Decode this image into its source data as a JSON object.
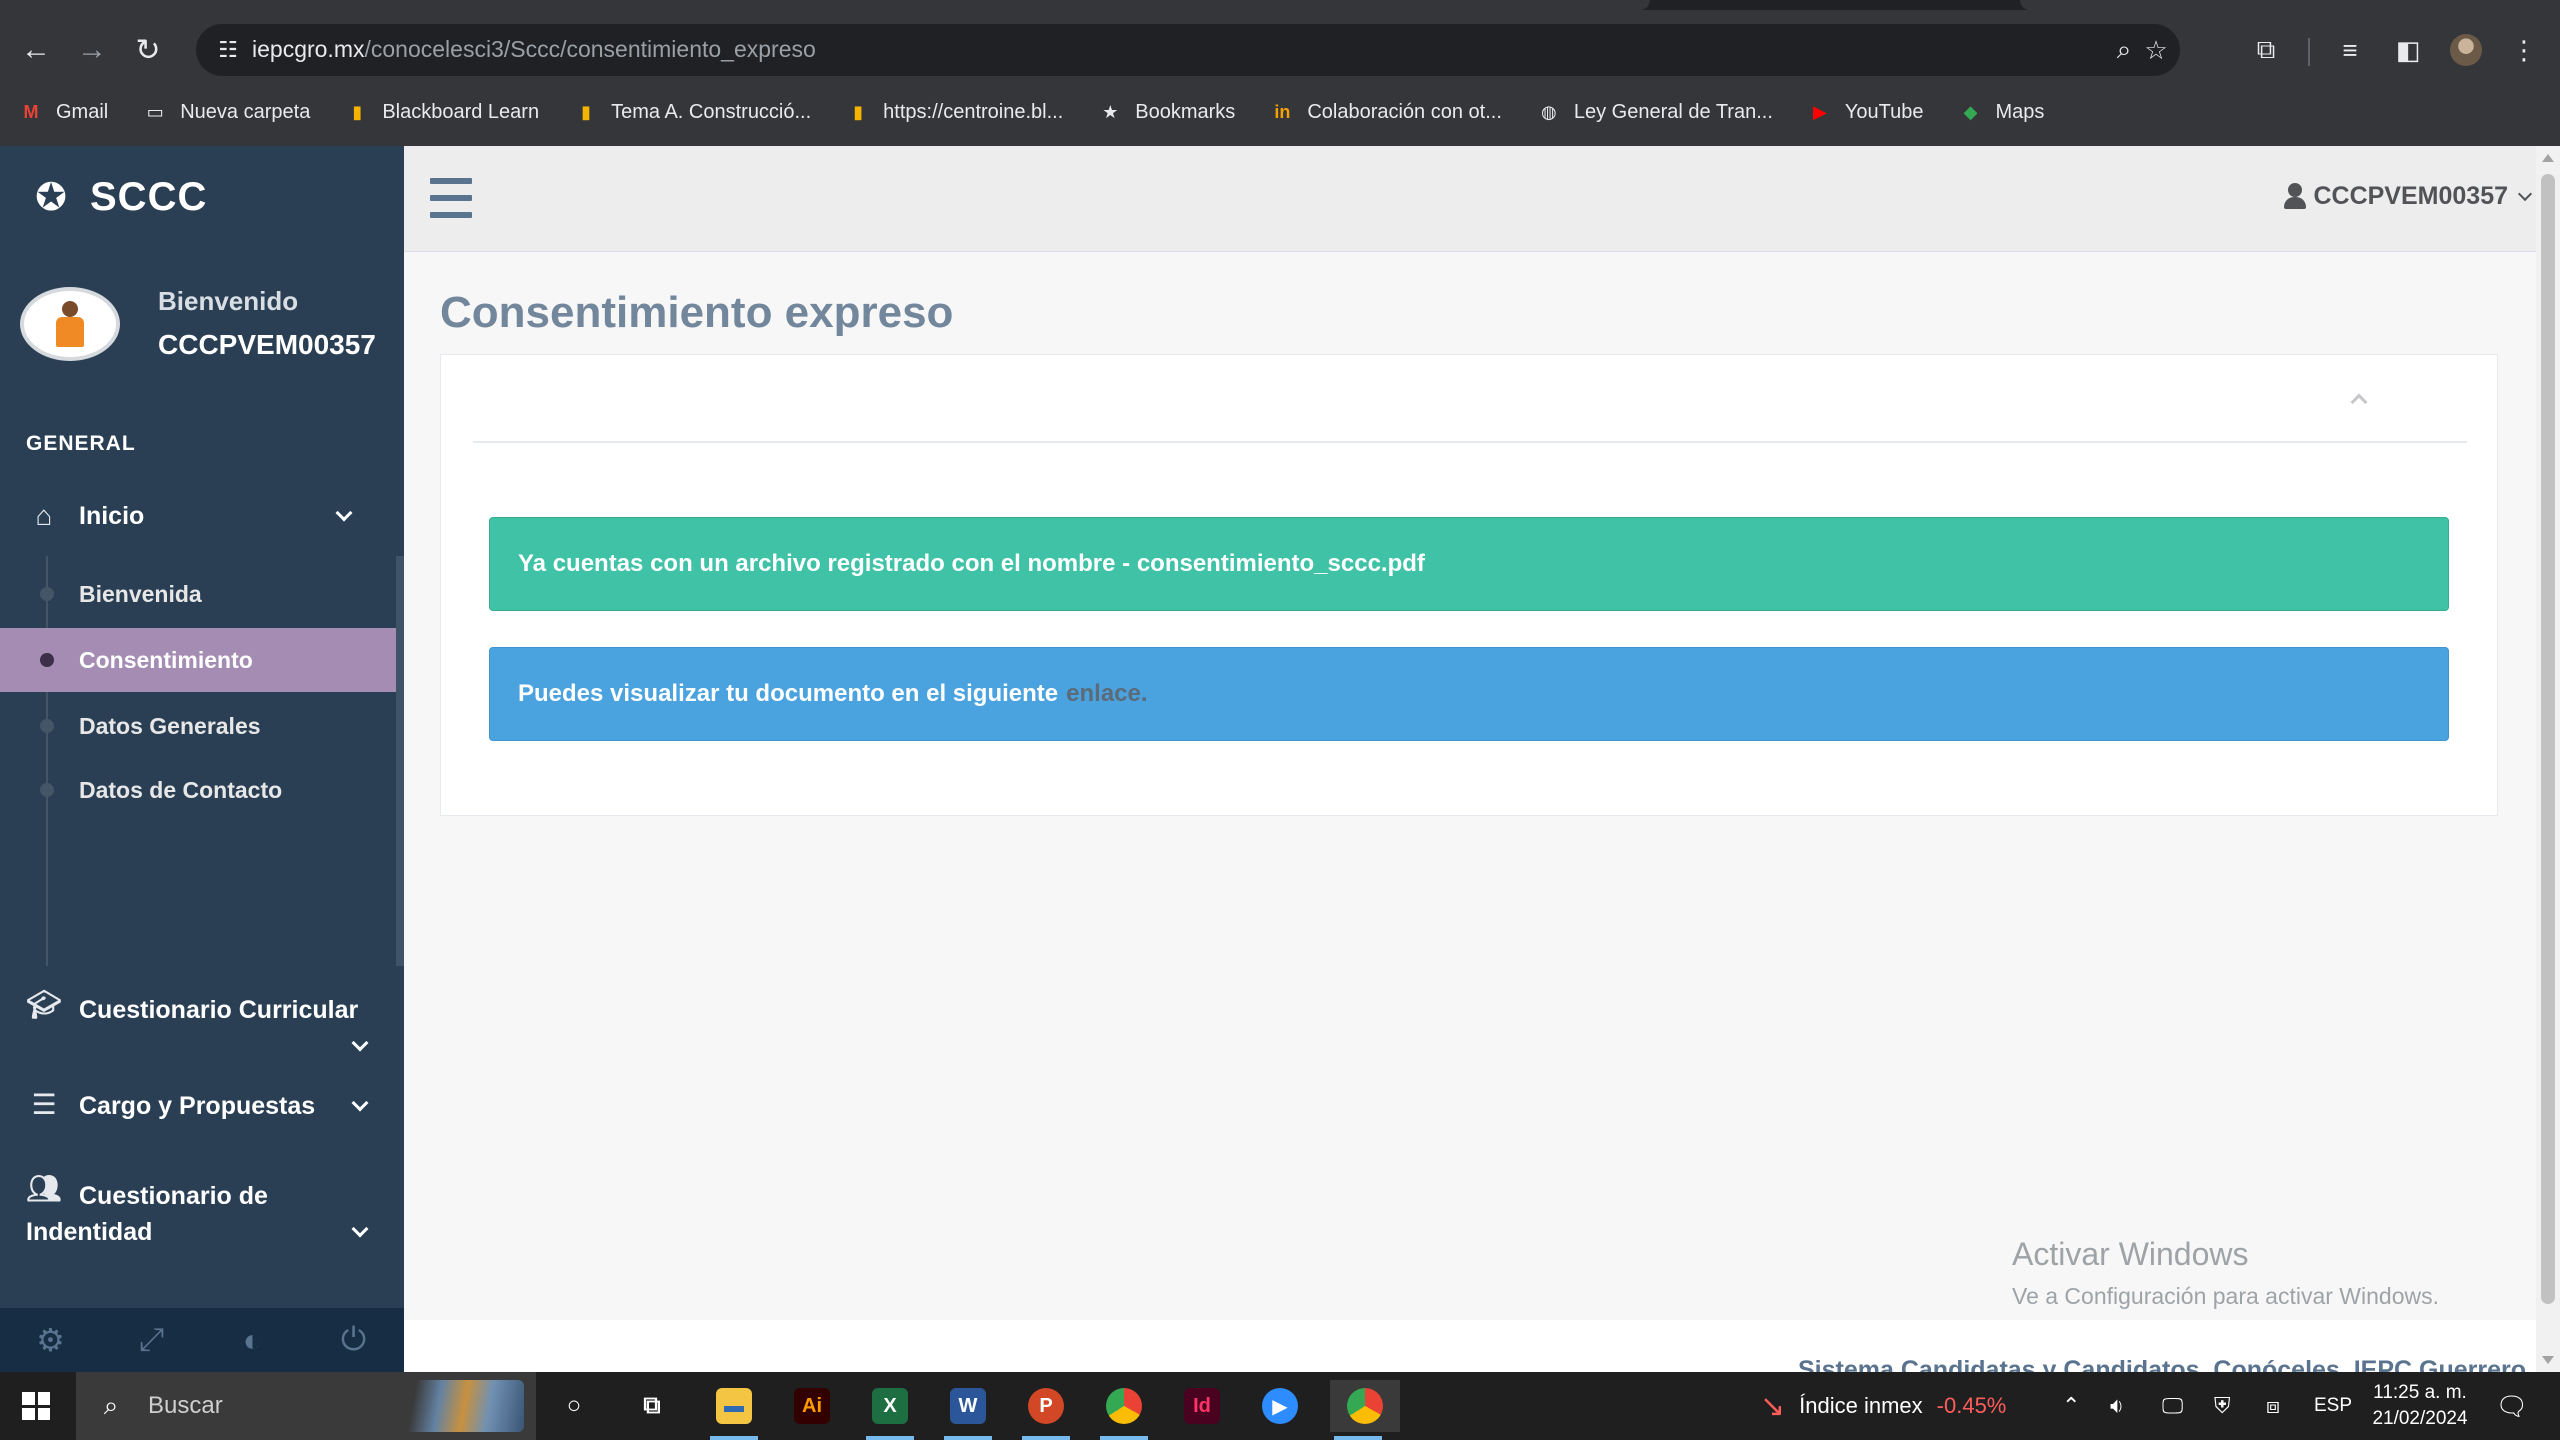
{
  "browser": {
    "url_domain": "iepcgro.mx",
    "url_path": "/conocelesci3/Sccc/consentimiento_expreso",
    "bookmarks": [
      {
        "label": "Gmail",
        "icon": "gmail-icon"
      },
      {
        "label": "Nueva carpeta",
        "icon": "folder-icon"
      },
      {
        "label": "Blackboard Learn",
        "icon": "bar-chart-icon"
      },
      {
        "label": "Tema A. Construcció...",
        "icon": "bar-chart-icon"
      },
      {
        "label": "https://centroine.bl...",
        "icon": "bar-chart-icon"
      },
      {
        "label": "Bookmarks",
        "icon": "star-icon"
      },
      {
        "label": "Colaboración con ot...",
        "icon": "in-icon"
      },
      {
        "label": "Ley General de Tran...",
        "icon": "globe-icon"
      },
      {
        "label": "YouTube",
        "icon": "youtube-icon"
      },
      {
        "label": "Maps",
        "icon": "maps-icon"
      }
    ]
  },
  "sidebar": {
    "brand": "SCCC",
    "welcome": "Bienvenido",
    "user": "CCCPVEM00357",
    "section": "GENERAL",
    "menu": [
      {
        "label": "Inicio",
        "icon": "home-icon"
      },
      {
        "label": "Cuestionario Curricular",
        "icon": "graduation-cap-icon"
      },
      {
        "label": "Cargo y Propuestas",
        "icon": "list-icon"
      },
      {
        "label": "Cuestionario de Indentidad",
        "icon": "users-icon"
      }
    ],
    "submenu": [
      {
        "label": "Bienvenida"
      },
      {
        "label": "Consentimiento"
      },
      {
        "label": "Datos Generales"
      },
      {
        "label": "Datos de Contacto"
      }
    ]
  },
  "topnav": {
    "user": "CCCPVEM00357"
  },
  "main": {
    "title": "Consentimiento expreso",
    "alert_success": "Ya cuentas con un archivo registrado con el nombre - consentimiento_sccc.pdf",
    "alert_info": "Puedes visualizar tu documento en el siguiente",
    "alert_info_link": "enlace."
  },
  "watermark": {
    "line1": "Activar Windows",
    "line2": "Ve a Configuración para activar Windows."
  },
  "footer": {
    "text": "Sistema Candidatas y Candidatos, Conóceles. IEPC Guerrero"
  },
  "taskbar": {
    "search_label": "Buscar",
    "ticker_name": "Índice inmex",
    "ticker_change": "-0.45%",
    "language": "ESP",
    "time": "11:25 a. m.",
    "date": "21/02/2024"
  },
  "colors": {
    "sidebar": "#2a3f54",
    "submenu_active": "#a48cb3",
    "alert_success": "#3fc2a6",
    "alert_info": "#4aa3df",
    "title": "#73879c",
    "ticker_negative": "#ff5c5c"
  }
}
